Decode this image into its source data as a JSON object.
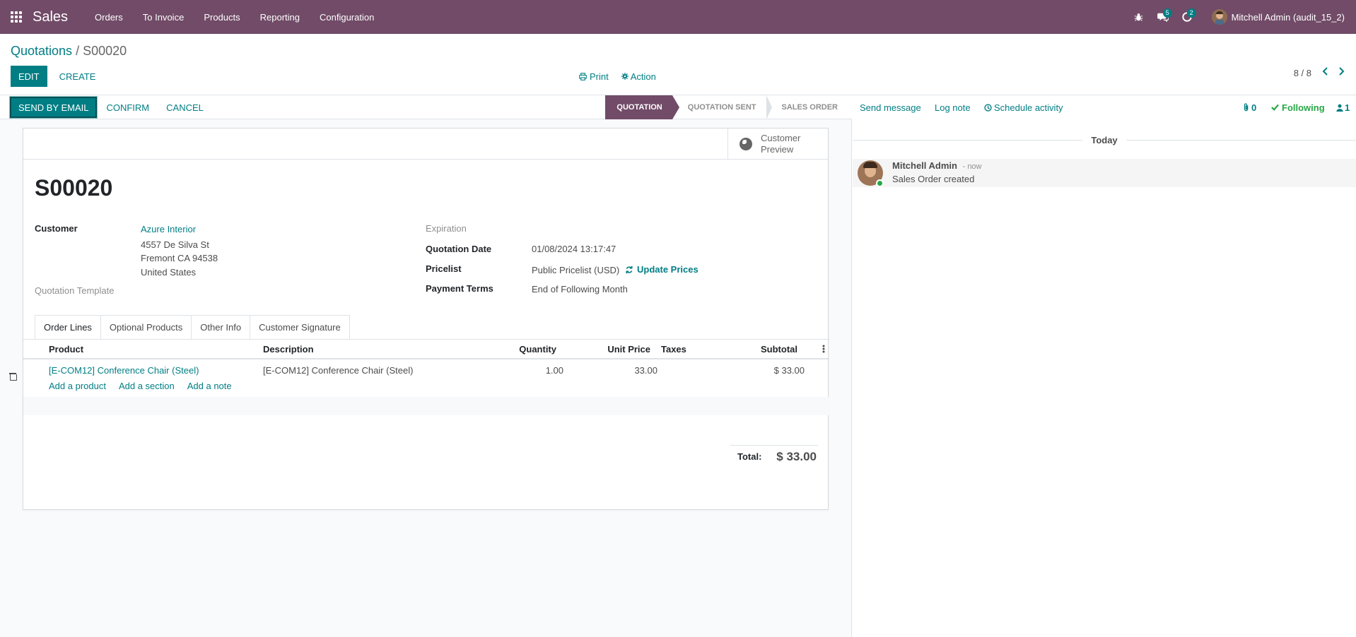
{
  "topbar": {
    "app_name": "Sales",
    "menu": [
      "Orders",
      "To Invoice",
      "Products",
      "Reporting",
      "Configuration"
    ],
    "messages_count": "5",
    "activities_count": "2",
    "user_name": "Mitchell Admin (audit_15_2)"
  },
  "breadcrumb": {
    "parent": "Quotations",
    "separator": "/",
    "current": "S00020"
  },
  "toolbar": {
    "edit": "EDIT",
    "create": "CREATE",
    "print": "Print",
    "action": "Action"
  },
  "pager": {
    "value": "8 / 8"
  },
  "statusbar": {
    "buttons": [
      "SEND BY EMAIL",
      "CONFIRM",
      "CANCEL"
    ],
    "stages": [
      {
        "label": "QUOTATION",
        "active": true
      },
      {
        "label": "QUOTATION SENT",
        "active": false
      },
      {
        "label": "SALES ORDER",
        "active": false
      }
    ]
  },
  "form": {
    "customer_preview": [
      "Customer",
      "Preview"
    ],
    "name": "S00020",
    "customer_label": "Customer",
    "customer_name": "Azure Interior",
    "customer_address": [
      "4557 De Silva St",
      "Fremont CA 94538",
      "United States"
    ],
    "template_label": "Quotation Template",
    "expiration_label": "Expiration",
    "quotation_date_label": "Quotation Date",
    "quotation_date": "01/08/2024 13:17:47",
    "pricelist_label": "Pricelist",
    "pricelist": "Public Pricelist (USD)",
    "update_prices": "Update Prices",
    "payment_terms_label": "Payment Terms",
    "payment_terms": "End of Following Month"
  },
  "tabs": [
    "Order Lines",
    "Optional Products",
    "Other Info",
    "Customer Signature"
  ],
  "order_lines": {
    "headers": {
      "product": "Product",
      "description": "Description",
      "quantity": "Quantity",
      "unit_price": "Unit Price",
      "taxes": "Taxes",
      "subtotal": "Subtotal"
    },
    "rows": [
      {
        "product": "[E-COM12] Conference Chair (Steel)",
        "description": "[E-COM12] Conference Chair (Steel)",
        "quantity": "1.00",
        "unit_price": "33.00",
        "taxes": "",
        "subtotal": "$ 33.00"
      }
    ],
    "add_links": [
      "Add a product",
      "Add a section",
      "Add a note"
    ]
  },
  "totals": {
    "label": "Total:",
    "value": "$ 33.00"
  },
  "chatter": {
    "send_message": "Send message",
    "log_note": "Log note",
    "schedule_activity": "Schedule activity",
    "attachments": "0",
    "following": "Following",
    "followers": "1",
    "today": "Today",
    "message": {
      "author": "Mitchell Admin",
      "time": "- now",
      "body": "Sales Order created"
    }
  },
  "colors": {
    "brand": "#714b67",
    "accent": "#017e84",
    "following": "#28a745"
  }
}
